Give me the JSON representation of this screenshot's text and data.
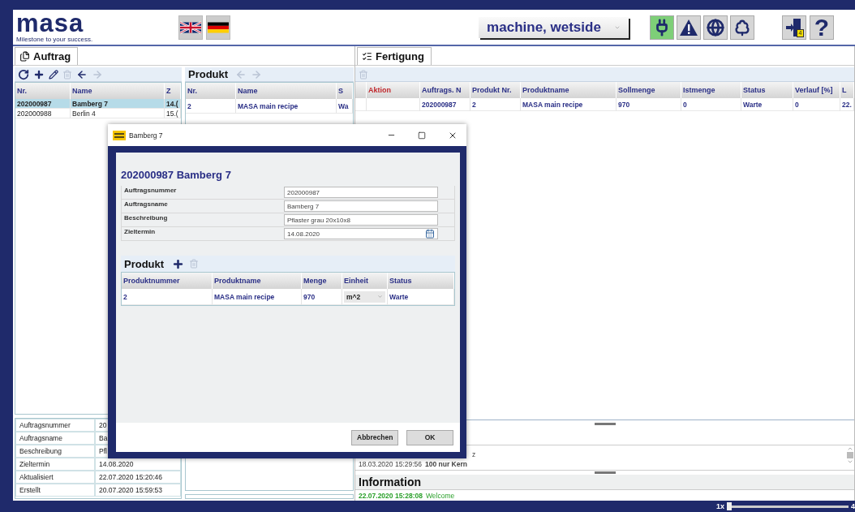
{
  "header": {
    "logo": "masa",
    "tagline": "Milestone to your success.",
    "machine_select": {
      "value": "machine, wetside"
    },
    "status_icons": [
      {
        "kind": "plug",
        "active": true
      },
      {
        "kind": "warning",
        "active": false
      },
      {
        "kind": "globe",
        "active": false
      },
      {
        "kind": "tree",
        "active": false
      }
    ],
    "exit_badge": "4",
    "help_label": "?"
  },
  "left_tab": {
    "label": "Auftrag",
    "selected": true
  },
  "orders": {
    "toolbar": [
      {
        "kind": "refresh",
        "disabled": false
      },
      {
        "kind": "add",
        "disabled": false
      },
      {
        "kind": "edit",
        "disabled": false
      },
      {
        "kind": "delete",
        "disabled": true
      },
      {
        "kind": "back",
        "disabled": false
      },
      {
        "kind": "forward",
        "disabled": true
      }
    ],
    "columns": [
      "Nr.",
      "Name",
      "Z"
    ],
    "rows": [
      {
        "cells": [
          "202000987",
          "Bamberg 7",
          "14.("
        ],
        "selected": true
      },
      {
        "cells": [
          "202000988",
          "Berlin 4",
          "15.("
        ],
        "selected": false
      }
    ],
    "details": [
      {
        "label": "Auftragsnummer",
        "value": "20"
      },
      {
        "label": "Auftragsname",
        "value": "Ba"
      },
      {
        "label": "Beschreibung",
        "value": "Pfl"
      },
      {
        "label": "Zieltermin",
        "value": "14.08.2020"
      },
      {
        "label": "Aktualisiert",
        "value": "22.07.2020 15:20:46"
      },
      {
        "label": "Erstellt",
        "value": "20.07.2020 15:59:53"
      }
    ]
  },
  "products": {
    "title": "Produkt",
    "toolbar": [
      {
        "kind": "back",
        "disabled": true
      },
      {
        "kind": "forward",
        "disabled": true
      }
    ],
    "columns": [
      "Nr.",
      "Name",
      "S"
    ],
    "rows": [
      {
        "cells": [
          "2",
          "MASA main recipe",
          "Wa"
        ],
        "selected": false
      }
    ]
  },
  "right_tab": {
    "label": "Fertigung",
    "selected": true
  },
  "production": {
    "toolbar": [
      {
        "kind": "delete",
        "disabled": true
      }
    ],
    "columns": [
      "",
      "Aktion",
      "Auftrags. N",
      "Produkt Nr.",
      "Produktname",
      "Sollmenge",
      "Istmenge",
      "Status",
      "Verlauf [%]",
      "L"
    ],
    "rows": [
      [
        "",
        "",
        "202000987",
        "2",
        "MASA main recipe",
        "970",
        "0",
        "Warte",
        "0",
        "22."
      ]
    ]
  },
  "log": [
    {
      "text": "z"
    },
    {
      "time": "18.03.2020 15:29:56",
      "text": "100 nur Kern"
    }
  ],
  "information": {
    "title": "Information",
    "entries": [
      {
        "time": "22.07.2020 15:28:08",
        "text": "Welcome"
      }
    ]
  },
  "zoom": {
    "min_label": "1x",
    "max_label": "4",
    "level": 0
  },
  "dialog": {
    "title": "Bamberg 7",
    "heading": "202000987 Bamberg 7",
    "fields": [
      {
        "label": "Auftragsnummer",
        "value": "202000987",
        "kind": "text"
      },
      {
        "label": "Auftragsname",
        "value": "Bamberg 7",
        "kind": "text"
      },
      {
        "label": "Beschreibung",
        "value": "Pflaster grau 20x10x8",
        "kind": "text"
      },
      {
        "label": "Zieltermin",
        "value": "14.08.2020",
        "kind": "date"
      }
    ],
    "product_title": "Produkt",
    "product_columns": [
      "Produktnummer",
      "Produktname",
      "Menge",
      "Einheit",
      "Status"
    ],
    "product_rows": [
      {
        "number": "2",
        "name": "MASA main recipe",
        "amount": "970",
        "unit": "m^2",
        "status": "Warte"
      }
    ],
    "buttons": [
      "Abbrechen",
      "OK"
    ]
  }
}
